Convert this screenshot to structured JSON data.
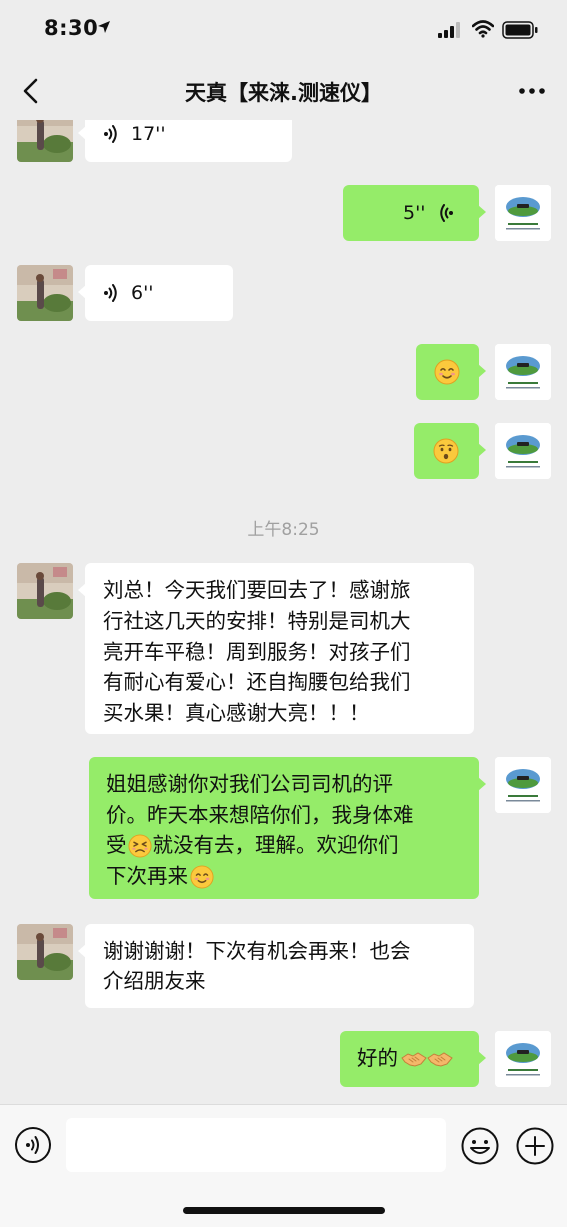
{
  "status_bar": {
    "time": "8:30"
  },
  "header": {
    "title": "天真【来涞.测速仪】"
  },
  "messages": {
    "m1": {
      "duration": "17''"
    },
    "m2": {
      "duration": "5''"
    },
    "m3": {
      "duration": "6''"
    },
    "ts": "上午8:25",
    "m6": {
      "text": [
        "刘总！今天我们要回去了！感谢旅",
        "行社这几天的安排！特别是司机大",
        "亮开车平稳！周到服务！对孩子们",
        "有耐心有爱心！还自掏腰包给我们",
        "买水果！真心感谢大亮！！！"
      ]
    },
    "m7": {
      "line1": "姐姐感谢你对我们公司司机的评",
      "line2": "价。昨天本来想陪你们，我身体难",
      "line3a": "受",
      "line3b": "就没有去，理解。欢迎你们",
      "line4": "下次再来"
    },
    "m8": {
      "line1": "谢谢谢谢！下次有机会再来！也会",
      "line2": "介绍朋友来"
    },
    "m9": {
      "text": "好的"
    }
  },
  "colors": {
    "background": "#ededed",
    "sent_bubble": "#95ec69",
    "received_bubble": "#ffffff"
  }
}
